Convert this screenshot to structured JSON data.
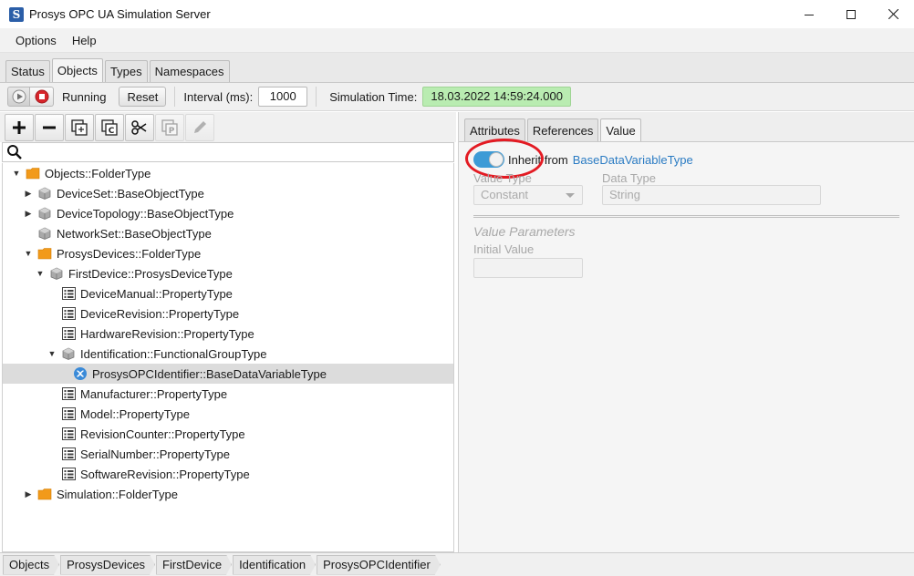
{
  "window": {
    "title": "Prosys OPC UA Simulation Server"
  },
  "menu": [
    "Options",
    "Help"
  ],
  "tabs": [
    {
      "label": "Status",
      "active": false
    },
    {
      "label": "Objects",
      "active": true
    },
    {
      "label": "Types",
      "active": false
    },
    {
      "label": "Namespaces",
      "active": false
    }
  ],
  "toolbar": {
    "status": "Running",
    "reset_label": "Reset",
    "interval_label": "Interval (ms):",
    "interval_value": "1000",
    "simtime_label": "Simulation Time:",
    "simtime_value": "18.03.2022 14:59:24.000",
    "simtime_color": "#b9ecb1"
  },
  "tree_toolbar_icons": [
    "add-icon",
    "remove-icon",
    "copy-icon",
    "copy-special-icon",
    "cut-icon",
    "paste-icon",
    "edit-icon"
  ],
  "search": {
    "value": "",
    "placeholder": ""
  },
  "tree": [
    {
      "label": "Objects::FolderType",
      "level": 0,
      "expander": "expanded",
      "icon": "folder-icon"
    },
    {
      "label": "DeviceSet::BaseObjectType",
      "level": 1,
      "expander": "collapsed",
      "icon": "object-icon"
    },
    {
      "label": "DeviceTopology::BaseObjectType",
      "level": 1,
      "expander": "collapsed",
      "icon": "object-icon"
    },
    {
      "label": "NetworkSet::BaseObjectType",
      "level": 1,
      "expander": "none",
      "icon": "object-icon"
    },
    {
      "label": "ProsysDevices::FolderType",
      "level": 1,
      "expander": "expanded",
      "icon": "folder-icon"
    },
    {
      "label": "FirstDevice::ProsysDeviceType",
      "level": 2,
      "expander": "expanded",
      "icon": "object-icon"
    },
    {
      "label": "DeviceManual::PropertyType",
      "level": 3,
      "expander": "none",
      "icon": "property-icon"
    },
    {
      "label": "DeviceRevision::PropertyType",
      "level": 3,
      "expander": "none",
      "icon": "property-icon"
    },
    {
      "label": "HardwareRevision::PropertyType",
      "level": 3,
      "expander": "none",
      "icon": "property-icon"
    },
    {
      "label": "Identification::FunctionalGroupType",
      "level": 3,
      "expander": "expanded",
      "icon": "object-icon"
    },
    {
      "label": "ProsysOPCIdentifier::BaseDataVariableType",
      "level": 4,
      "expander": "none",
      "icon": "variable-icon",
      "selected": true
    },
    {
      "label": "Manufacturer::PropertyType",
      "level": 3,
      "expander": "none",
      "icon": "property-icon"
    },
    {
      "label": "Model::PropertyType",
      "level": 3,
      "expander": "none",
      "icon": "property-icon"
    },
    {
      "label": "RevisionCounter::PropertyType",
      "level": 3,
      "expander": "none",
      "icon": "property-icon"
    },
    {
      "label": "SerialNumber::PropertyType",
      "level": 3,
      "expander": "none",
      "icon": "property-icon"
    },
    {
      "label": "SoftwareRevision::PropertyType",
      "level": 3,
      "expander": "none",
      "icon": "property-icon"
    },
    {
      "label": "Simulation::FolderType",
      "level": 1,
      "expander": "collapsed",
      "icon": "folder-icon"
    }
  ],
  "details": {
    "tabs": [
      {
        "label": "Attributes",
        "active": false
      },
      {
        "label": "References",
        "active": false
      },
      {
        "label": "Value",
        "active": true
      }
    ],
    "inherit_label": "Inherit from",
    "inherit_link": "BaseDataVariableType",
    "inherit_on": true,
    "toggle_color": "#3d9bd6",
    "value_type_label": "Value Type",
    "value_type_value": "Constant",
    "data_type_label": "Data Type",
    "data_type_value": "String",
    "section_title": "Value Parameters",
    "initial_value_label": "Initial Value",
    "initial_value": "",
    "highlight_color": "#e31b23"
  },
  "breadcrumb": [
    "Objects",
    "ProsysDevices",
    "FirstDevice",
    "Identification",
    "ProsysOPCIdentifier"
  ]
}
